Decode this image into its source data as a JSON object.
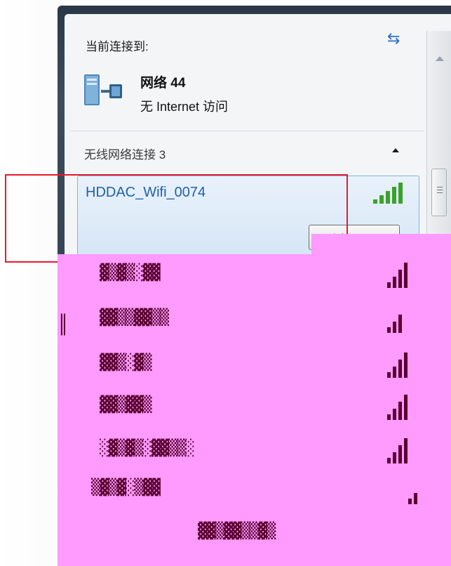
{
  "header": {
    "current_connection_label": "当前连接到:"
  },
  "connected_network": {
    "name": "网络  44",
    "status": "无 Internet 访问"
  },
  "wireless": {
    "section_title": "无线网络连接 3",
    "selected_network": {
      "ssid": "HDDAC_Wifi_0074",
      "signal_strength": 5,
      "connect_label": "连接(C)"
    }
  },
  "annotation": {
    "highlight_color": "#e8192c"
  },
  "colors": {
    "wifi_name": "#1d5fb0",
    "signal": "#3aa22c",
    "selection_fill": "#d3e4f5",
    "corrupted_region": "#ff9aff"
  },
  "icons": {
    "refresh": "refresh-icon",
    "network": "network-icon",
    "signal": "signal-bars-icon",
    "collapse": "chevron-up-icon"
  }
}
